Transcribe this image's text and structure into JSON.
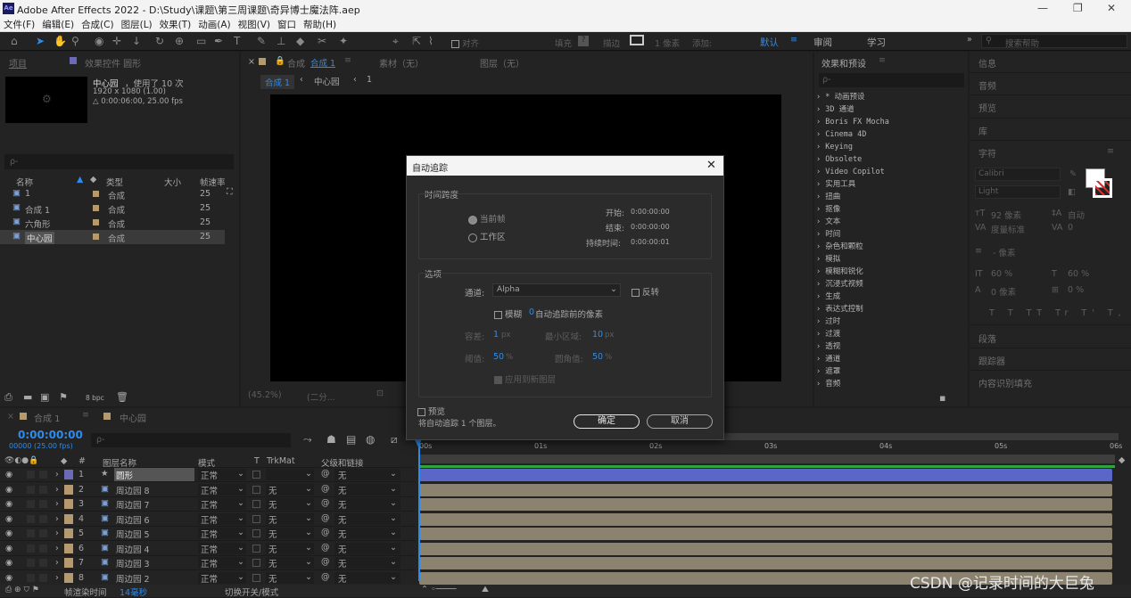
{
  "window": {
    "app_title": "Adobe After Effects 2022 - D:\\Study\\课题\\第三周课题\\奇异博士魔法阵.aep",
    "logo": "Ae",
    "minimize": "—",
    "maximize": "❐",
    "close": "✕"
  },
  "menu": [
    "文件(F)",
    "编辑(E)",
    "合成(C)",
    "图层(L)",
    "效果(T)",
    "动画(A)",
    "视图(V)",
    "窗口",
    "帮助(H)"
  ],
  "toolbar": {
    "align": "对齐",
    "fill": "填充",
    "stroke": "描边",
    "px": "1 像素",
    "add": "添加:",
    "workspaces": [
      "默认",
      "审阅",
      "学习"
    ],
    "search_placeholder": "搜索帮助"
  },
  "project": {
    "tab_project": "项目",
    "tab_effects": "效果控件 圆形",
    "comp_name": "中心园",
    "used": "，使用了 10 次",
    "resolution": "1920 x 1080 (1.00)",
    "duration": "△ 0:00:06:00, 25.00 fps",
    "search_placeholder": "ρ-",
    "cols": {
      "name": "名称",
      "type": "类型",
      "size": "大小",
      "rate": "帧速率"
    },
    "items": [
      {
        "name": "1",
        "type": "合成",
        "rate": "25"
      },
      {
        "name": "合成 1",
        "type": "合成",
        "rate": "25"
      },
      {
        "name": "六角形",
        "type": "合成",
        "rate": "25"
      },
      {
        "name": "中心园",
        "type": "合成",
        "rate": "25"
      }
    ],
    "bpc": "8 bpc"
  },
  "viewer": {
    "tab_comp": "合成 1",
    "tab_footage": "素材（无）",
    "tab_layer": "图层（无）",
    "crumb1": "合成 1",
    "crumb2": "中心园",
    "crumb3": "1",
    "zoom": "(45.2%)",
    "res": "(二分..."
  },
  "effects": {
    "tab": "效果和预设",
    "search": "ρ-",
    "items": [
      "* 动画预设",
      "3D 通道",
      "Boris FX Mocha",
      "Cinema 4D",
      "Keying",
      "Obsolete",
      "Video Copilot",
      "实用工具",
      "扭曲",
      "抠像",
      "文本",
      "时间",
      "杂色和颗粒",
      "模拟",
      "模糊和锐化",
      "沉浸式视频",
      "生成",
      "表达式控制",
      "过时",
      "过渡",
      "透视",
      "通道",
      "遮罩",
      "音频"
    ]
  },
  "right_panels": {
    "info": "信息",
    "audio": "音频",
    "preview": "预览",
    "lib": "库",
    "char": "字符",
    "font": "Calibri",
    "style": "Light",
    "size": "92 像素",
    "leading": "自动",
    "kern": "度量标准",
    "track": "0",
    "unit": "- 像素",
    "vscale": "60 %",
    "hscale": "60 %",
    "baseline": "0 像素",
    "tsume": "0 %",
    "para": "段落",
    "tracker": "跟踪器",
    "fill": "内容识别填充"
  },
  "dialog": {
    "title": "自动追踪",
    "timespan": "时间跨度",
    "opt_current": "当前帧",
    "opt_work": "工作区",
    "start_l": "开始:",
    "start_v": "0:00:00:00",
    "end_l": "结束:",
    "end_v": "0:00:00:00",
    "dur_l": "持续时间:",
    "dur_v": "0:00:00:01",
    "options": "选项",
    "channel_l": "通道:",
    "channel_v": "Alpha",
    "invert": "反转",
    "blur_pre": "模糊",
    "blur_val": "0",
    "blur_post": "自动追踪前的像素",
    "tol_l": "容差:",
    "tol_v": "1",
    "px": "px",
    "minarea_l": "最小区域:",
    "minarea_v": "10",
    "thresh_l": "阈值:",
    "thresh_v": "50",
    "pct": "%",
    "corner_l": "圆角值:",
    "corner_v": "50",
    "apply_new": "应用到新图层",
    "preview": "预览",
    "status": "将自动追踪 1 个图层。",
    "ok": "确定",
    "cancel": "取消"
  },
  "timeline": {
    "tab1": "合成 1",
    "tab2": "中心园",
    "timecode": "0:00:00:00",
    "frames": "00000 (25.00 fps)",
    "search": "ρ-",
    "cols": {
      "num": "#",
      "name": "图层名称",
      "mode": "模式",
      "t": "T",
      "trkmat": "TrkMat",
      "parent": "父级和链接"
    },
    "ticks": [
      "00s",
      "01s",
      "02s",
      "03s",
      "04s",
      "05s",
      "06s"
    ],
    "layers": [
      {
        "num": "1",
        "name": "圆形",
        "mode": "正常",
        "trk": "",
        "parent": "无",
        "color": "#6a6ab8"
      },
      {
        "num": "2",
        "name": "周边园 8",
        "mode": "正常",
        "trk": "无",
        "parent": "无",
        "color": "#b49a6e"
      },
      {
        "num": "3",
        "name": "周边园 7",
        "mode": "正常",
        "trk": "无",
        "parent": "无",
        "color": "#b49a6e"
      },
      {
        "num": "4",
        "name": "周边园 6",
        "mode": "正常",
        "trk": "无",
        "parent": "无",
        "color": "#b49a6e"
      },
      {
        "num": "5",
        "name": "周边园 5",
        "mode": "正常",
        "trk": "无",
        "parent": "无",
        "color": "#b49a6e"
      },
      {
        "num": "6",
        "name": "周边园 4",
        "mode": "正常",
        "trk": "无",
        "parent": "无",
        "color": "#b49a6e"
      },
      {
        "num": "7",
        "name": "周边园 3",
        "mode": "正常",
        "trk": "无",
        "parent": "无",
        "color": "#b49a6e"
      },
      {
        "num": "8",
        "name": "周边园 2",
        "mode": "正常",
        "trk": "无",
        "parent": "无",
        "color": "#b49a6e"
      }
    ],
    "render_l": "帧渲染时间",
    "render_v": "14毫秒",
    "switch": "切换开关/模式"
  },
  "watermark": "CSDN @记录时间的大巨兔"
}
